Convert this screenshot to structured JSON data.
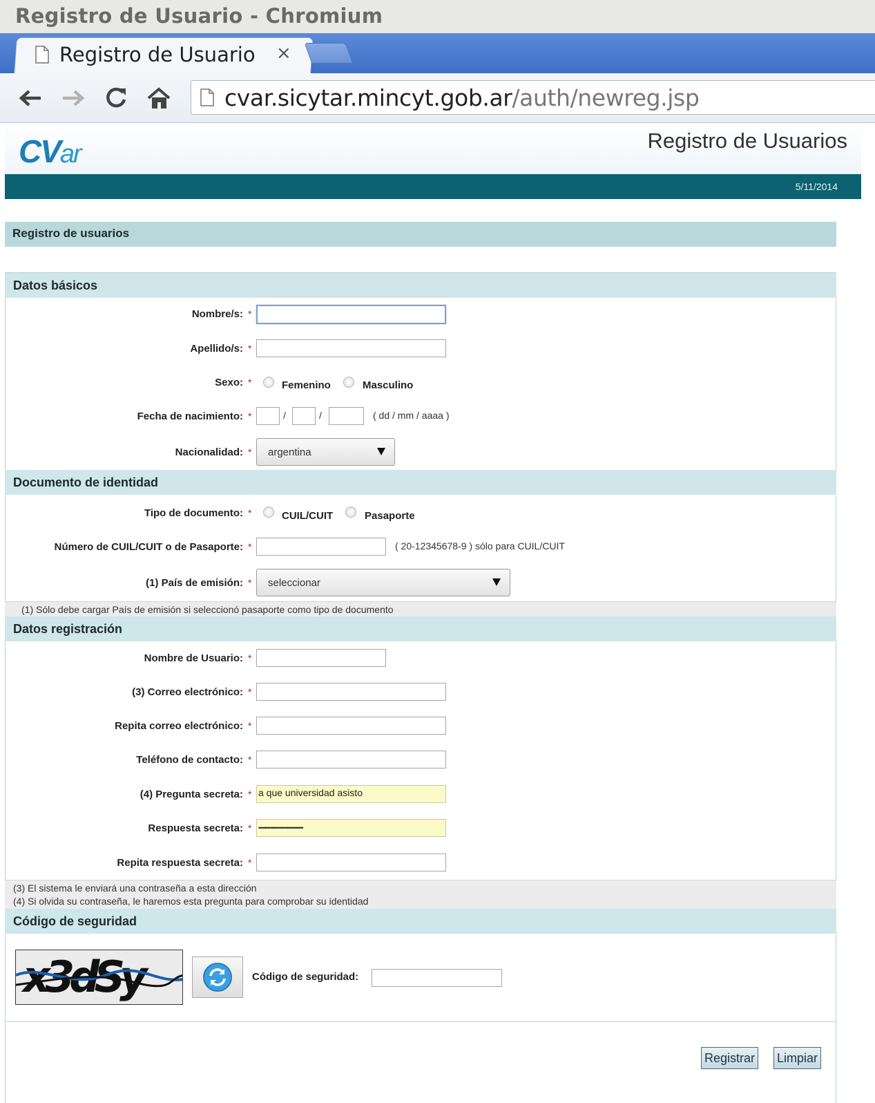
{
  "window": {
    "title": "Registro de Usuario - Chromium"
  },
  "tab": {
    "label": "Registro de Usuario",
    "close": "×"
  },
  "address_bar": {
    "host": "cvar.sicytar.mincyt.gob.ar",
    "path": "/auth/newreg.jsp"
  },
  "header": {
    "logo_main": "CV",
    "logo_sub": "ar",
    "title": "Registro de Usuarios",
    "date": "5/11/2014"
  },
  "page_title": "Registro de usuarios",
  "sections": {
    "basic": "Datos básicos",
    "document": "Documento de identidad",
    "registration": "Datos registración",
    "security": "Código de seguridad"
  },
  "basic": {
    "nombre_label": "Nombre/s:",
    "apellido_label": "Apellido/s:",
    "sexo_label": "Sexo:",
    "femenino": "Femenino",
    "masculino": "Masculino",
    "fecha_label": "Fecha de nacimiento:",
    "sep": "/",
    "fecha_hint": "( dd / mm / aaaa )",
    "nacionalidad_label": "Nacionalidad:",
    "nacionalidad_value": "argentina"
  },
  "document": {
    "tipo_label": "Tipo de documento:",
    "cuil": "CUIL/CUIT",
    "pasaporte": "Pasaporte",
    "numero_label": "Número de CUIL/CUIT o de Pasaporte:",
    "numero_hint": "( 20-12345678-9 ) sólo para CUIL/CUIT",
    "pais_label": "(1) País de emisión:",
    "pais_value": "seleccionar",
    "note1": "(1) Sólo debe cargar País de emisión si seleccionó pasaporte como tipo de documento"
  },
  "registration": {
    "usuario_label": "Nombre de Usuario:",
    "correo_label": "(3) Correo electrónico:",
    "correo2_label": "Repita correo electrónico:",
    "telefono_label": "Teléfono de contacto:",
    "pregunta_label": "(4) Pregunta secreta:",
    "pregunta_value": "a que universidad asisto",
    "respuesta_label": "Respuesta secreta:",
    "respuesta_value": "••••••••••••••••••••••••••••••",
    "respuesta2_label": "Repita respuesta secreta:",
    "note3": "(3) El sistema le enviará una contraseña a esta dirección",
    "note4": "(4) Si olvida su contraseña, le haremos esta pregunta para comprobar su identidad"
  },
  "security": {
    "captcha_text": "x3dSy",
    "codigo_label": "Código de seguridad:"
  },
  "required_mark": "*",
  "buttons": {
    "registrar": "Registrar",
    "limpiar": "Limpiar"
  },
  "colors": {
    "teal_bar": "#0c6270",
    "section_bg": "#cfe6ea",
    "tab_blue": "#4a7bd0",
    "required": "#c0202b"
  }
}
